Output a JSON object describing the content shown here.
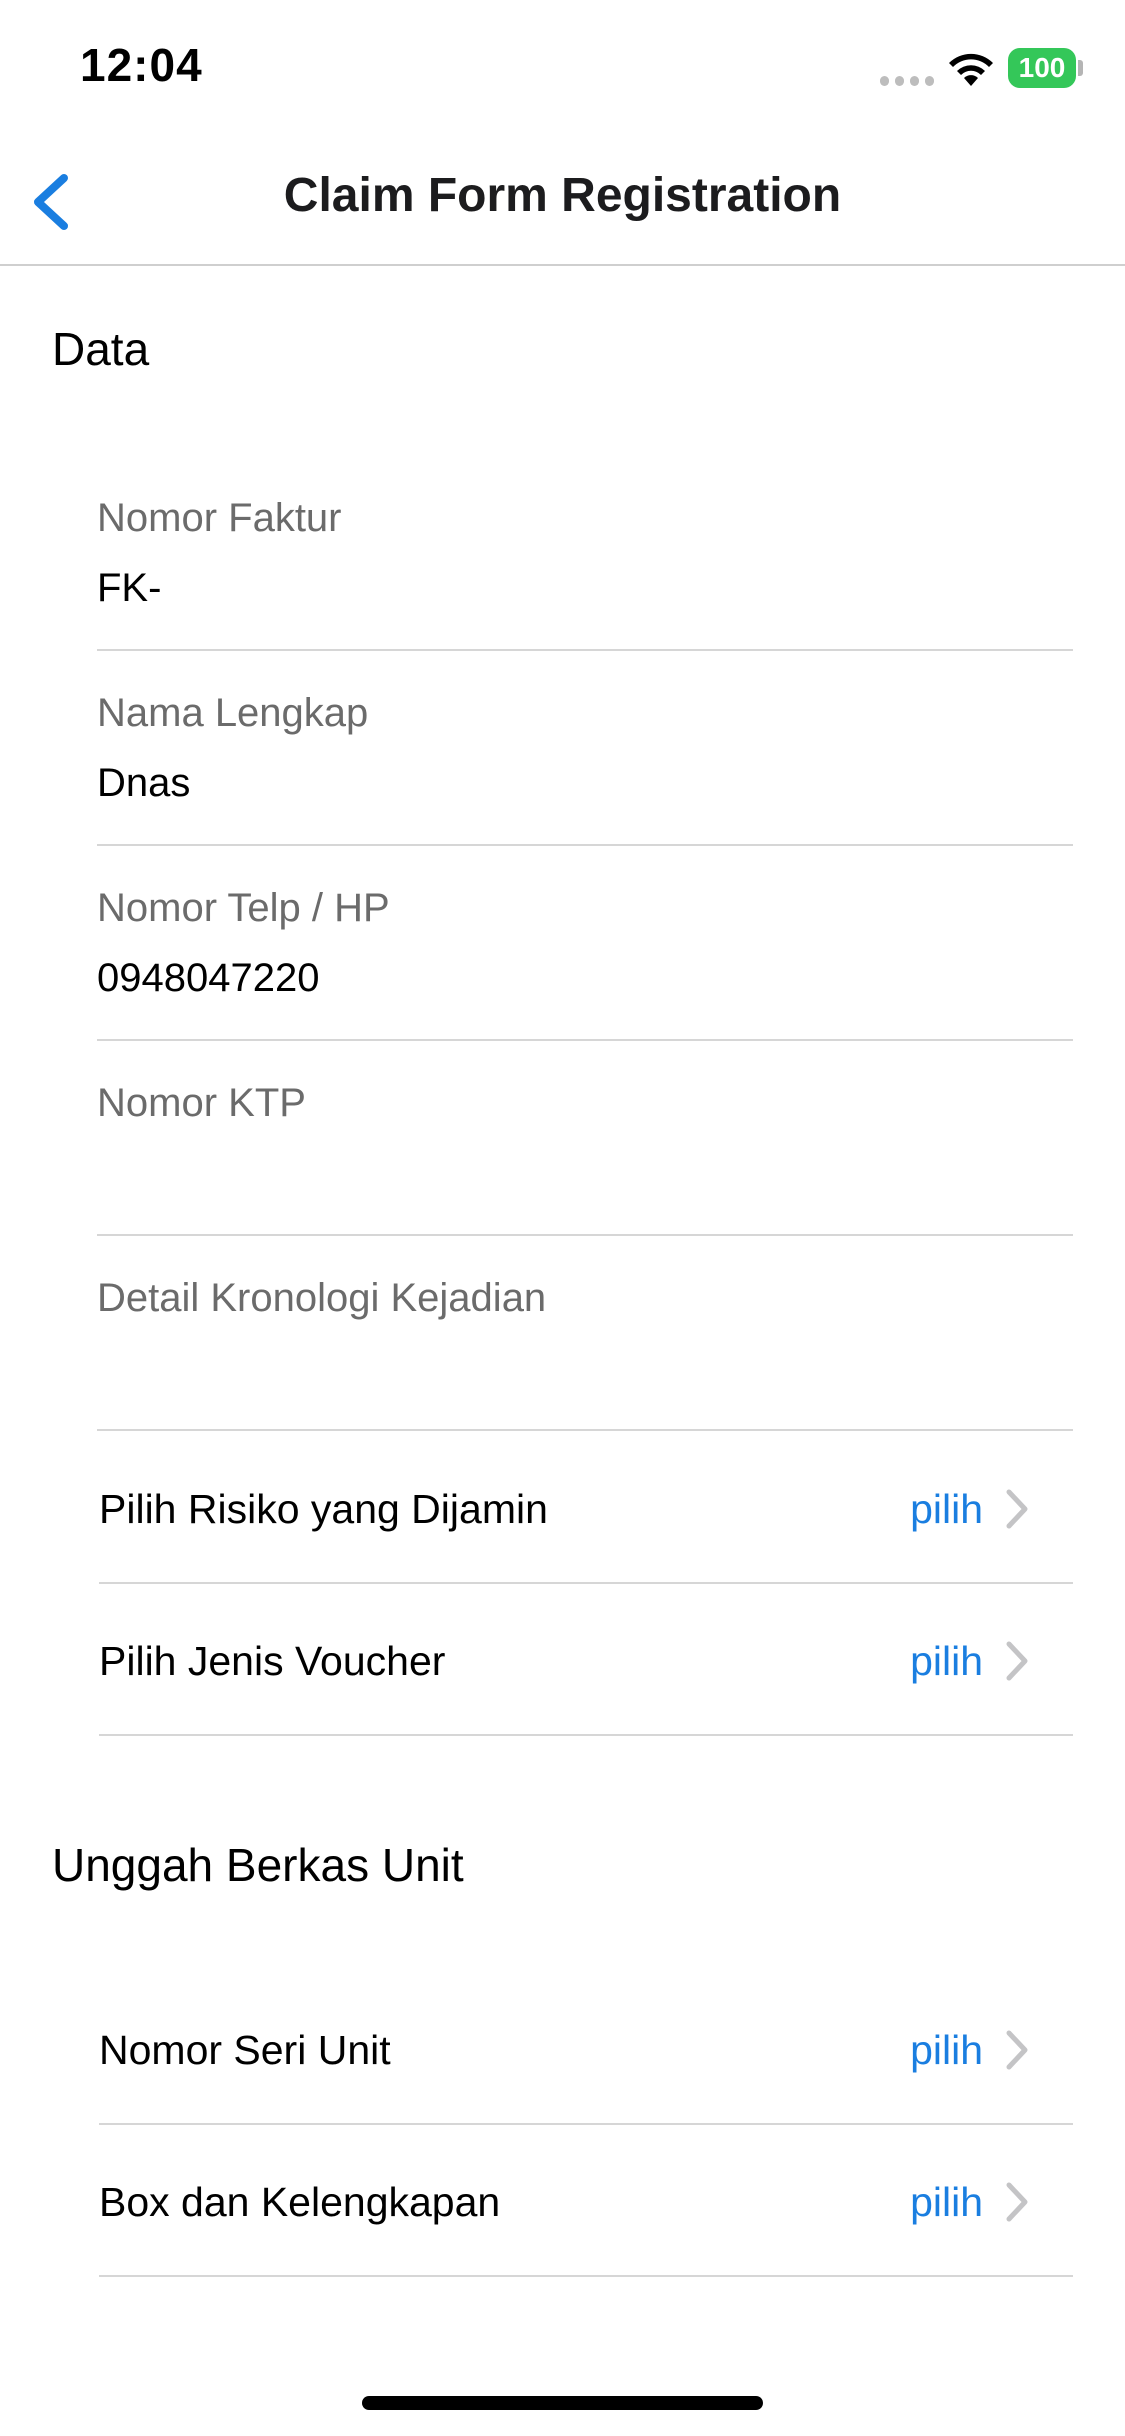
{
  "status_bar": {
    "time": "12:04",
    "battery": "100"
  },
  "nav": {
    "title": "Claim Form Registration",
    "back_icon": "chevron-left-icon"
  },
  "sections": {
    "data_title": "Data",
    "upload_title": "Unggah Berkas Unit"
  },
  "fields": [
    {
      "label": "Nomor Faktur",
      "value": "FK-"
    },
    {
      "label": "Nama Lengkap",
      "value": "Dnas"
    },
    {
      "label": "Nomor Telp / HP",
      "value": "0948047220"
    },
    {
      "label": "Nomor KTP",
      "value": ""
    },
    {
      "label": "Detail Kronologi Kejadian",
      "value": ""
    }
  ],
  "selectors": [
    {
      "label": "Pilih Risiko yang Dijamin",
      "action": "pilih"
    },
    {
      "label": "Pilih Jenis Voucher",
      "action": "pilih"
    }
  ],
  "uploads": [
    {
      "label": "Nomor Seri Unit",
      "action": "pilih"
    },
    {
      "label": "Box dan Kelengkapan",
      "action": "pilih"
    }
  ],
  "colors": {
    "accent": "#1a7ee0",
    "battery": "#34c759",
    "label": "#6b6b6b",
    "divider": "#d6d6d6"
  }
}
